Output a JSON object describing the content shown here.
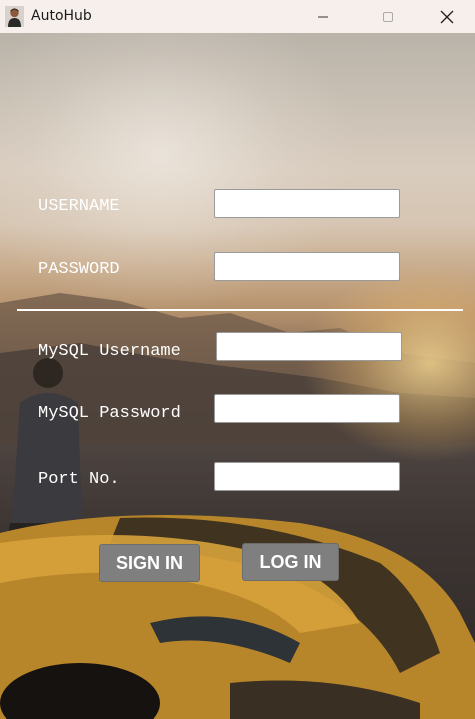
{
  "window": {
    "title": "AutoHub"
  },
  "form": {
    "username_label": "USERNAME",
    "password_label": "PASSWORD",
    "mysql_username_label": "MySQL Username",
    "mysql_password_label": "MySQL Password",
    "port_label": "Port No.",
    "username_value": "",
    "password_value": "",
    "mysql_username_value": "",
    "mysql_password_value": "",
    "port_value": ""
  },
  "buttons": {
    "sign_in": "SIGN IN",
    "log_in": "LOG IN"
  },
  "colors": {
    "titlebar": "#f7efec",
    "button": "#7f7f7f",
    "label_text": "#ffffff"
  },
  "icons": {
    "app": "person-avatar-icon",
    "minimize": "minimize-icon",
    "maximize": "maximize-icon",
    "close": "close-icon"
  }
}
